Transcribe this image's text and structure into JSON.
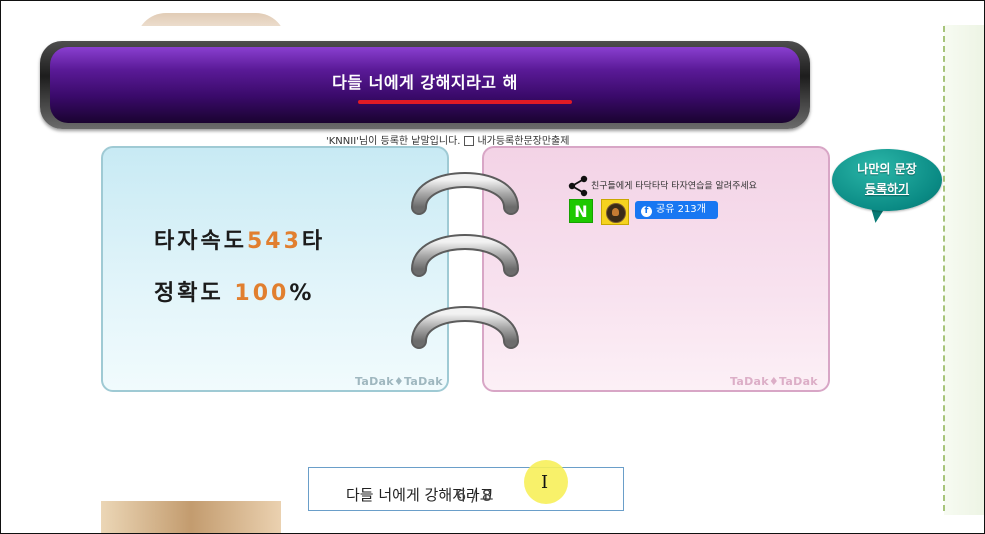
{
  "banner": {
    "title": "다들 너에게 강해지라고 해"
  },
  "registration": {
    "text": "'KNNII'님이 등록한 낱말입니다.",
    "checkbox_label": "내가등록한문장만출제"
  },
  "result": {
    "speed_label": "타자속도",
    "speed_value": "543",
    "speed_unit": "타",
    "accuracy_label": "정확도",
    "accuracy_value": "100",
    "accuracy_unit": "%"
  },
  "watermarks": {
    "left": "TaDak♦TaDak",
    "right": "TaDak♦TaDak"
  },
  "share": {
    "text": "친구들에게 타닥타닥 타자연습을 알려주세요",
    "naver_label": "N",
    "facebook_label": "공유 213개"
  },
  "bubble": {
    "line1": "나만의 문장",
    "line2": "등록하기"
  },
  "input": {
    "typed_text": "다들 너에게 강해지라고",
    "page_counter": "6 / 8"
  },
  "colors": {
    "accent_orange": "#e17f2f",
    "banner_purple": "#5a1a97",
    "underline_red": "#e01b24",
    "facebook_blue": "#1877f2",
    "naver_green": "#1ec800",
    "bubble_teal": "#0a8a84"
  },
  "icons": [
    "share-icon",
    "naver-icon",
    "kakaostory-icon",
    "facebook-icon",
    "text-cursor-icon"
  ]
}
